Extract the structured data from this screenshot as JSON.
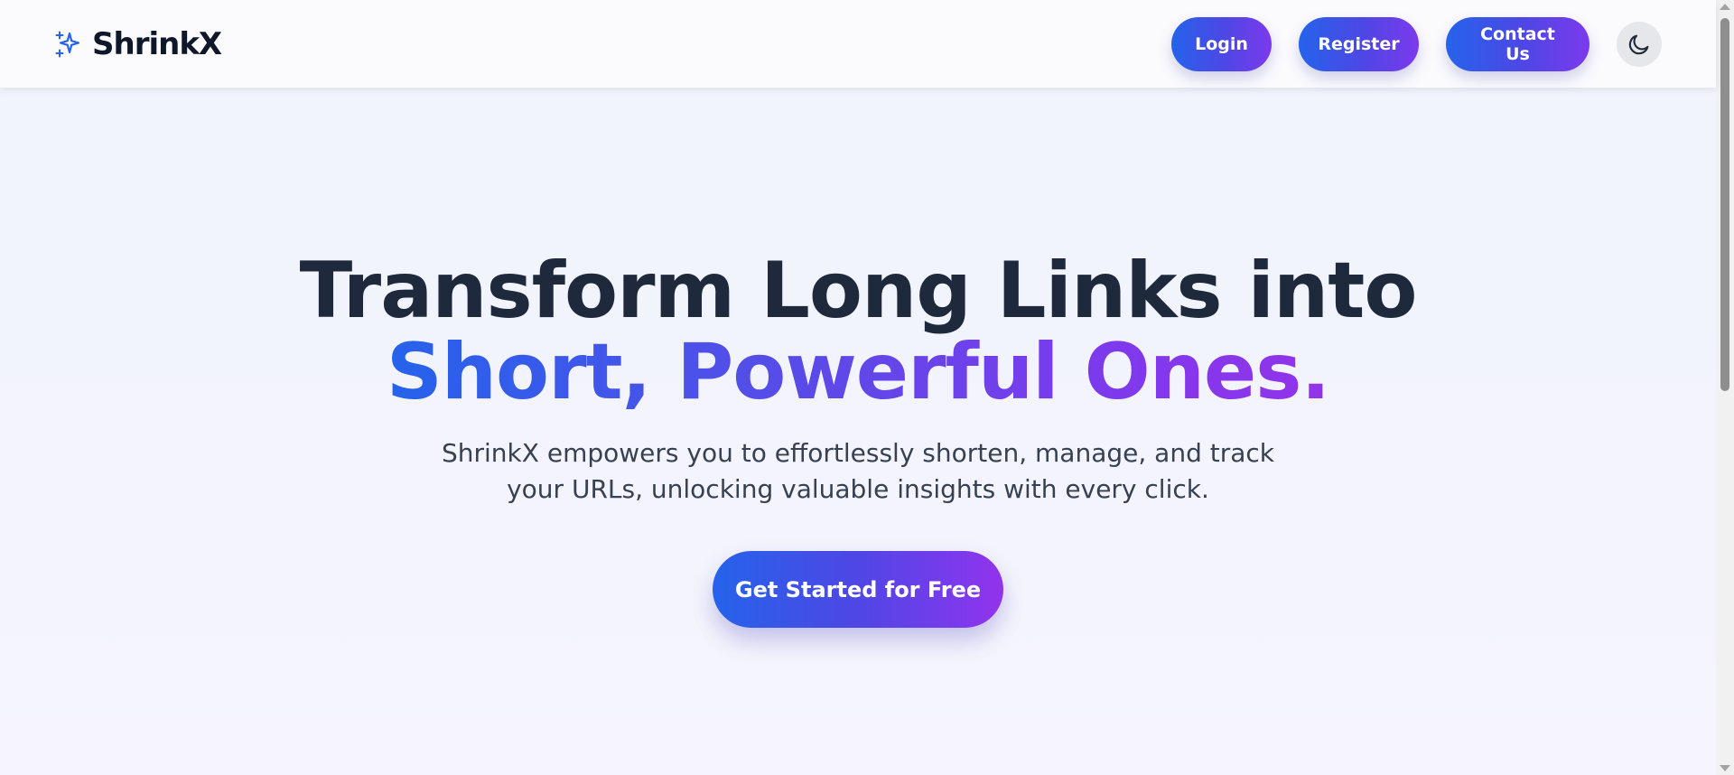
{
  "brand": {
    "name": "ShrinkX",
    "icon": "sparkles-icon",
    "accent": "#2563eb"
  },
  "nav": {
    "login_label": "Login",
    "register_label": "Register",
    "contact_label": "Contact Us",
    "theme_toggle_icon": "moon-icon"
  },
  "hero": {
    "title_line_1": "Transform Long Links into",
    "title_line_2": "Short, Powerful Ones.",
    "subtitle": "ShrinkX empowers you to effortlessly shorten, manage, and track your URLs, unlocking valuable insights with every click.",
    "cta_label": "Get Started for Free"
  },
  "colors": {
    "gradient_start": "#2563eb",
    "gradient_end": "#9333ea",
    "heading": "#1e293b",
    "body_text": "#374151"
  }
}
